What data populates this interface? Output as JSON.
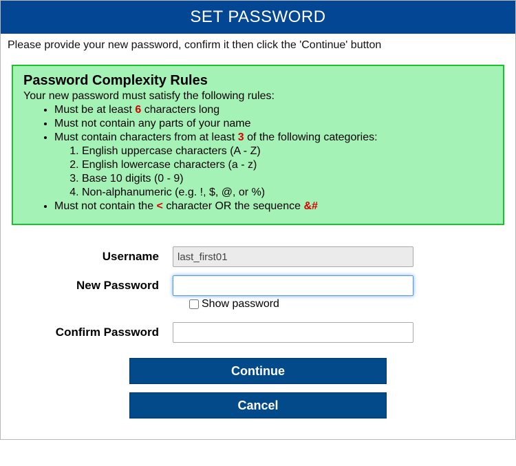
{
  "header": {
    "title": "SET PASSWORD"
  },
  "instruction": "Please provide your new password, confirm it then click the 'Continue' button",
  "rules": {
    "title": "Password Complexity Rules",
    "intro": "Your new password must satisfy the following rules:",
    "r1_a": "Must be at least ",
    "r1_hl": "6",
    "r1_b": " characters long",
    "r2": "Must not contain any parts of your name",
    "r3_a": "Must contain characters from at least ",
    "r3_hl": "3",
    "r3_b": " of the following categories:",
    "c1": "English uppercase characters (A - Z)",
    "c2": "English lowercase characters (a - z)",
    "c3": "Base 10 digits (0 - 9)",
    "c4": "Non-alphanumeric (e.g. !, $, @, or %)",
    "r4_a": "Must not contain the ",
    "r4_hl1": "<",
    "r4_b": " character OR the sequence ",
    "r4_hl2": "&#"
  },
  "form": {
    "username_label": "Username",
    "username_value": "last_first01",
    "newpw_label": "New Password",
    "newpw_value": "",
    "showpw_label": "Show password",
    "confirmpw_label": "Confirm Password",
    "confirmpw_value": ""
  },
  "buttons": {
    "continue": "Continue",
    "cancel": "Cancel"
  }
}
